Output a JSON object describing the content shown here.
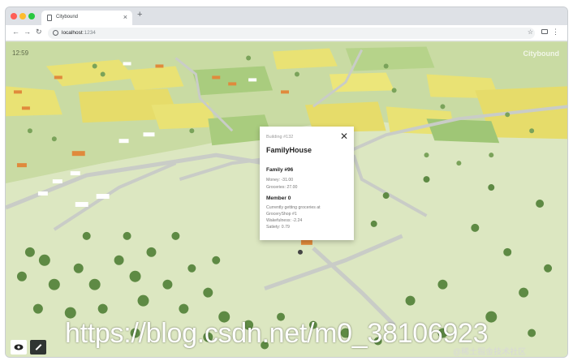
{
  "browser": {
    "tab_title": "Citybound",
    "url_host": "localhost",
    "url_port": ":1234"
  },
  "app": {
    "clock": "12:59",
    "brand": "Citybound"
  },
  "popup": {
    "building_id": "Building #132",
    "building_type": "FamilyHouse",
    "family_title": "Family #96",
    "money": "Money: -31.00",
    "groceries": "Groceries: 27.00",
    "member_title": "Member 0",
    "activity": "Currently getting groceries at",
    "shop": "GroceryShop #1",
    "wakefulness": "Wakefulness: -2.24",
    "satiety": "Satiety: 0.79"
  },
  "watermark": {
    "url": "https://blog.csdn.net/m0_38106923",
    "credit": "@稀土掘金技术社区"
  },
  "colors": {
    "grass": "#dce7c1",
    "field_yellow": "#e9e274",
    "field_green": "#a9cc7e",
    "tree": "#5e8a44",
    "road": "#c9ccc7",
    "roof": "#e08a3c"
  }
}
